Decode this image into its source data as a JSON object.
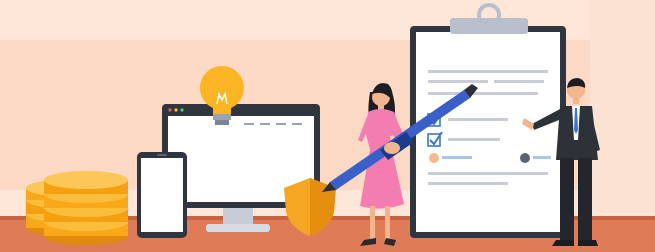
{
  "scene": {
    "kind": "illustration",
    "subjects": [
      "coin-stack",
      "light-bulb",
      "desktop-monitor",
      "smartphone",
      "shield",
      "woman-with-pen",
      "clipboard-checklist",
      "businessman-presenting"
    ],
    "colors": {
      "background_top": "#fde7da",
      "background_band": "#f9d4be",
      "floor": "#e07b57",
      "floor_dark": "#c9623f",
      "coin": "#f9a81a",
      "coin_shadow": "#e08b0e",
      "bulb": "#fbb524",
      "shield": "#f5a623",
      "monitor_frame": "#2f3640",
      "screen": "#ffffff",
      "pen_blue": "#3a5fc8",
      "dress_pink": "#f37cb0",
      "suit_dark": "#2d3138",
      "clipboard_paper": "#ffffff",
      "checklist_lines": "#c7ccd6",
      "checkbox_blue": "#3a78c9"
    },
    "checklist": {
      "checked_items": 2,
      "assignee_rows": 1
    }
  }
}
